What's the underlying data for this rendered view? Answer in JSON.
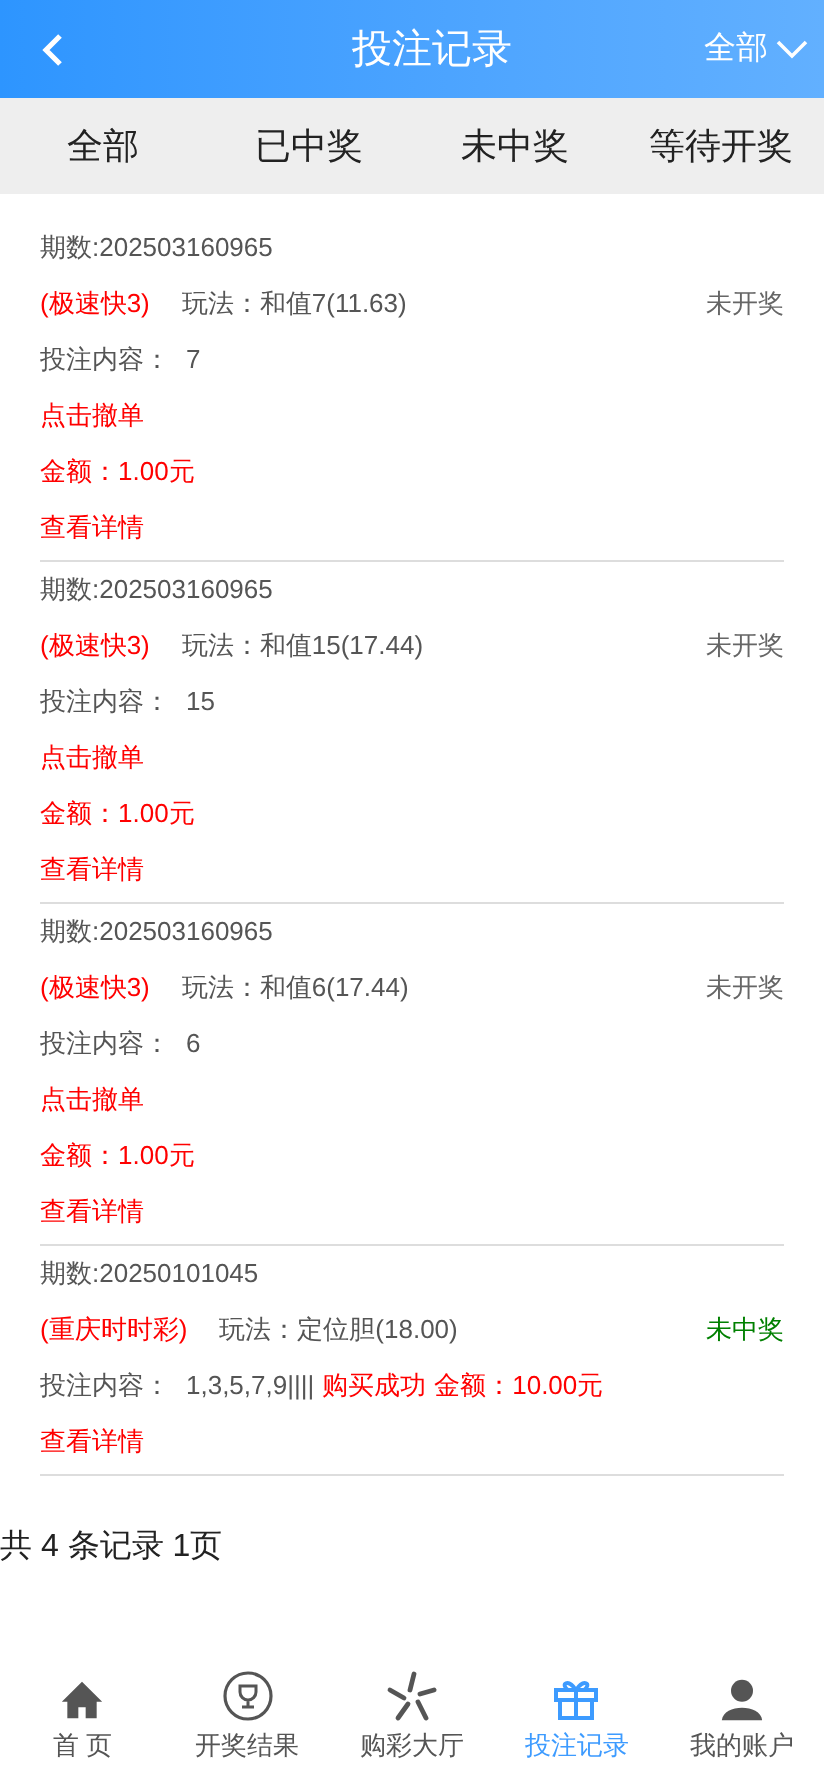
{
  "header": {
    "title": "投注记录",
    "filter": "全部"
  },
  "tabs": [
    {
      "label": "全部",
      "selected": false
    },
    {
      "label": "已中奖",
      "selected": false
    },
    {
      "label": "未中奖",
      "selected": false
    },
    {
      "label": "等待开奖",
      "selected": false
    }
  ],
  "records": [
    {
      "kind": "pending",
      "issue": "期数:202503160965",
      "lottery": "(极速快3)",
      "play": "玩法：和值7(11.63)",
      "status": "未开奖",
      "color": "#666666",
      "content_label": "投注内容：",
      "content": "7",
      "cancel": "点击撤单",
      "amount": "金额：1.00元",
      "details": "查看详情"
    },
    {
      "kind": "pending",
      "issue": "期数:202503160965",
      "lottery": "(极速快3)",
      "play": "玩法：和值15(17.44)",
      "status": "未开奖",
      "color": "#666666",
      "content_label": "投注内容：",
      "content": "15",
      "cancel": "点击撤单",
      "amount": "金额：1.00元",
      "details": "查看详情"
    },
    {
      "kind": "pending",
      "issue": "期数:202503160965",
      "lottery": "(极速快3)",
      "play": "玩法：和值6(17.44)",
      "status": "未开奖",
      "color": "#666666",
      "content_label": "投注内容：",
      "content": "6",
      "cancel": "点击撤单",
      "amount": "金额：1.00元",
      "details": "查看详情"
    },
    {
      "kind": "settled",
      "issue": "期数:20250101045",
      "lottery": "(重庆时时彩)",
      "play": "玩法：定位胆(18.00)",
      "status": "未中奖",
      "color": "#008000",
      "content_label": "投注内容：",
      "content": "1,3,5,7,9||||",
      "result": "购买成功",
      "amount": "金额：10.00元",
      "details": "查看详情"
    }
  ],
  "summary": "共 4 条记录 1页",
  "nav": [
    {
      "label": "首 页",
      "kind": "home",
      "selected": false
    },
    {
      "label": "开奖结果",
      "kind": "trophy",
      "selected": false
    },
    {
      "label": "购彩大厅",
      "kind": "star",
      "selected": false
    },
    {
      "label": "投注记录",
      "kind": "gift",
      "selected": true
    },
    {
      "label": "我的账户",
      "kind": "user",
      "selected": false
    }
  ]
}
